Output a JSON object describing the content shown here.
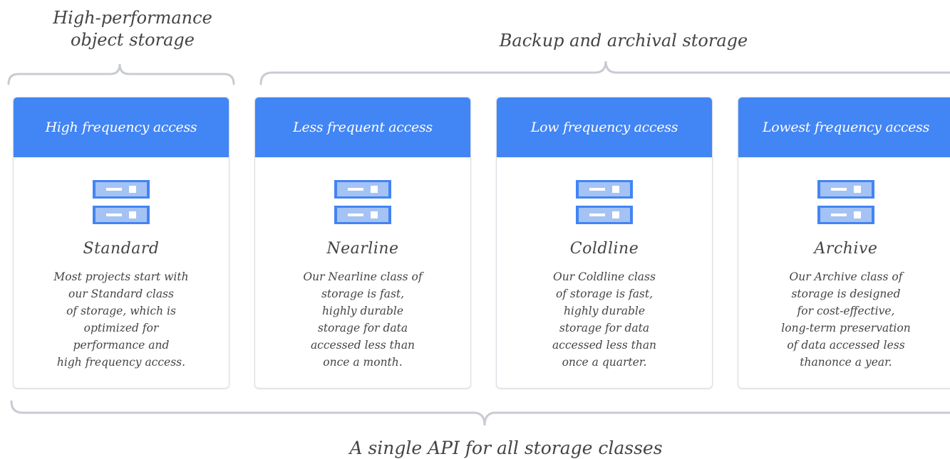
{
  "labels": {
    "high_performance": "High-performance\nobject storage",
    "backup": "Backup and archival storage",
    "api": "A single API for all storage classes"
  },
  "cards": [
    {
      "header": "High frequency access",
      "title": "Standard",
      "description": "Most projects start with\nour Standard class\nof storage, which is\noptimized for\nperformance and\nhigh frequency access."
    },
    {
      "header": "Less frequent access",
      "title": "Nearline",
      "description": "Our Nearline class of\nstorage is fast,\nhighly durable\nstorage for data\naccessed less than\nonce a month."
    },
    {
      "header": "Low frequency access",
      "title": "Coldline",
      "description": "Our Coldline class\nof storage is fast,\nhighly durable\nstorage for data\naccessed less than\nonce a quarter."
    },
    {
      "header": "Lowest frequency access",
      "title": "Archive",
      "description": "Our Archive class of\nstorage is designed\nfor cost-effective,\nlong-term preservation\nof data accessed less\nthanonce a year."
    }
  ],
  "colors": {
    "header_blue": "#4285f4",
    "icon_light": "#a4c2f4",
    "icon_dark": "#4285f4",
    "bracket": "#c8ccd2",
    "text": "#444444"
  },
  "icon": "storage-server-icon"
}
